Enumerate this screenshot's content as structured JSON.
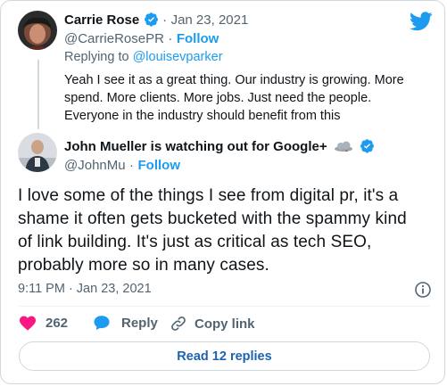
{
  "reply": {
    "author_name": "Carrie Rose",
    "sep": "·",
    "date": "Jan 23, 2021",
    "handle": "@CarrieRosePR",
    "follow": "Follow",
    "replying_prefix": "Replying to ",
    "replying_to": "@louisevparker",
    "text_line1": "Yeah I see it as a great thing. Our industry is growing. More",
    "text_line2": "spend. More clients. More jobs. Just need the people.",
    "text_line3": "Everyone in the industry should benefit from this"
  },
  "main": {
    "author_name": "John Mueller is watching out for Google+",
    "handle": "@JohnMu",
    "sep": "·",
    "follow": "Follow",
    "text_line1": "I love some of the things I see from digital pr, it's a",
    "text_line2": "shame it often gets bucketed with the spammy kind",
    "text_line3": "of link building. It's just as critical as tech SEO,",
    "text_line4": "probably more so in many cases.",
    "timestamp": "9:11 PM · Jan 23, 2021"
  },
  "actions": {
    "likes": "262",
    "reply": "Reply",
    "copy": "Copy link"
  },
  "read_replies": "Read 12 replies",
  "colors": {
    "accent": "#1d9bf0",
    "like": "#f91880",
    "muted": "#536471"
  },
  "icons": [
    "twitter-logo-icon",
    "verified-badge-icon",
    "cloud-emoji-icon",
    "info-icon",
    "heart-icon",
    "reply-bubble-icon",
    "link-icon"
  ]
}
